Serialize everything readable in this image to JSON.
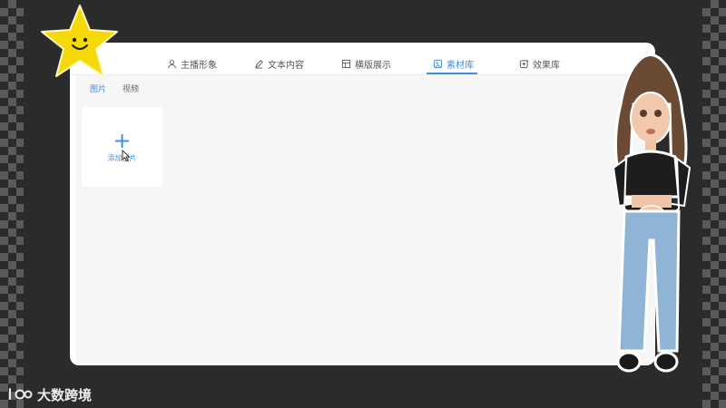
{
  "tabs": [
    {
      "label": "主播形象",
      "icon": "user-icon"
    },
    {
      "label": "文本内容",
      "icon": "edit-icon"
    },
    {
      "label": "横版展示",
      "icon": "layout-icon"
    },
    {
      "label": "素材库",
      "icon": "material-icon",
      "active": true
    },
    {
      "label": "效果库",
      "icon": "effect-icon"
    }
  ],
  "subtabs": [
    {
      "label": "图片",
      "active": true
    },
    {
      "label": "视频"
    }
  ],
  "add_card": {
    "plus": "+",
    "label": "添加图片"
  },
  "brand": {
    "text": "大数跨境",
    "logo_text": "大数"
  },
  "colors": {
    "accent": "#3d8fe8",
    "background": "#2b2b2b",
    "panel": "#f6f6f6",
    "star": "#f5d90a"
  }
}
